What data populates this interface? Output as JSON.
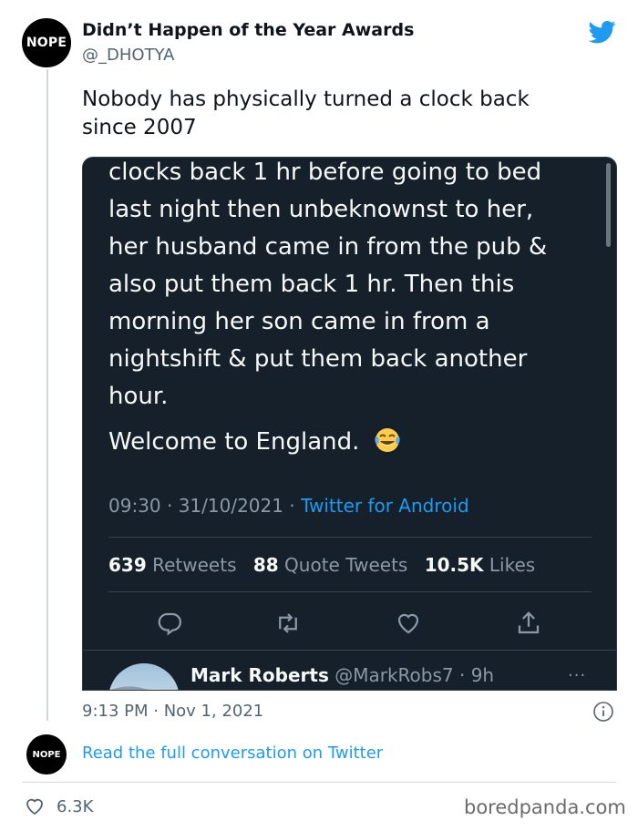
{
  "author": {
    "avatar_text": "NOPE",
    "display_name": "Didn’t Happen of the Year Awards",
    "handle": "@_DHOTYA"
  },
  "tweet": {
    "text": "Nobody has physically turned a clock back\nsince 2007",
    "timestamp": "9:13 PM · Nov 1, 2021"
  },
  "embed": {
    "body": "clocks back 1 hr before going to bed\nlast night then unbeknownst to her,\nher husband came in from the pub &\nalso put them back 1 hr. Then this\nmorning her son came in from a\nnightshift & put them back another\nhour.",
    "welcome": "Welcome to England.",
    "emoji_icon": "tears-of-joy-emoji",
    "meta_time": "09:30 · 31/10/2021 · ",
    "meta_source": "Twitter for Android",
    "stats": {
      "retweets_count": "639",
      "retweets_label": "Retweets",
      "quotes_count": "88",
      "quotes_label": "Quote Tweets",
      "likes_count": "10.5K",
      "likes_label": "Likes"
    },
    "reply": {
      "name": "Mark Roberts",
      "meta": "@MarkRobs7 · 9h",
      "more": "···"
    }
  },
  "footer": {
    "avatar_text": "NOPE",
    "read_link": "Read the full conversation on Twitter",
    "like_count": "6.3K",
    "watermark": "boredpanda.com"
  },
  "colors": {
    "twitter_blue": "#1d9bf0",
    "dark_bg": "#15202b"
  }
}
